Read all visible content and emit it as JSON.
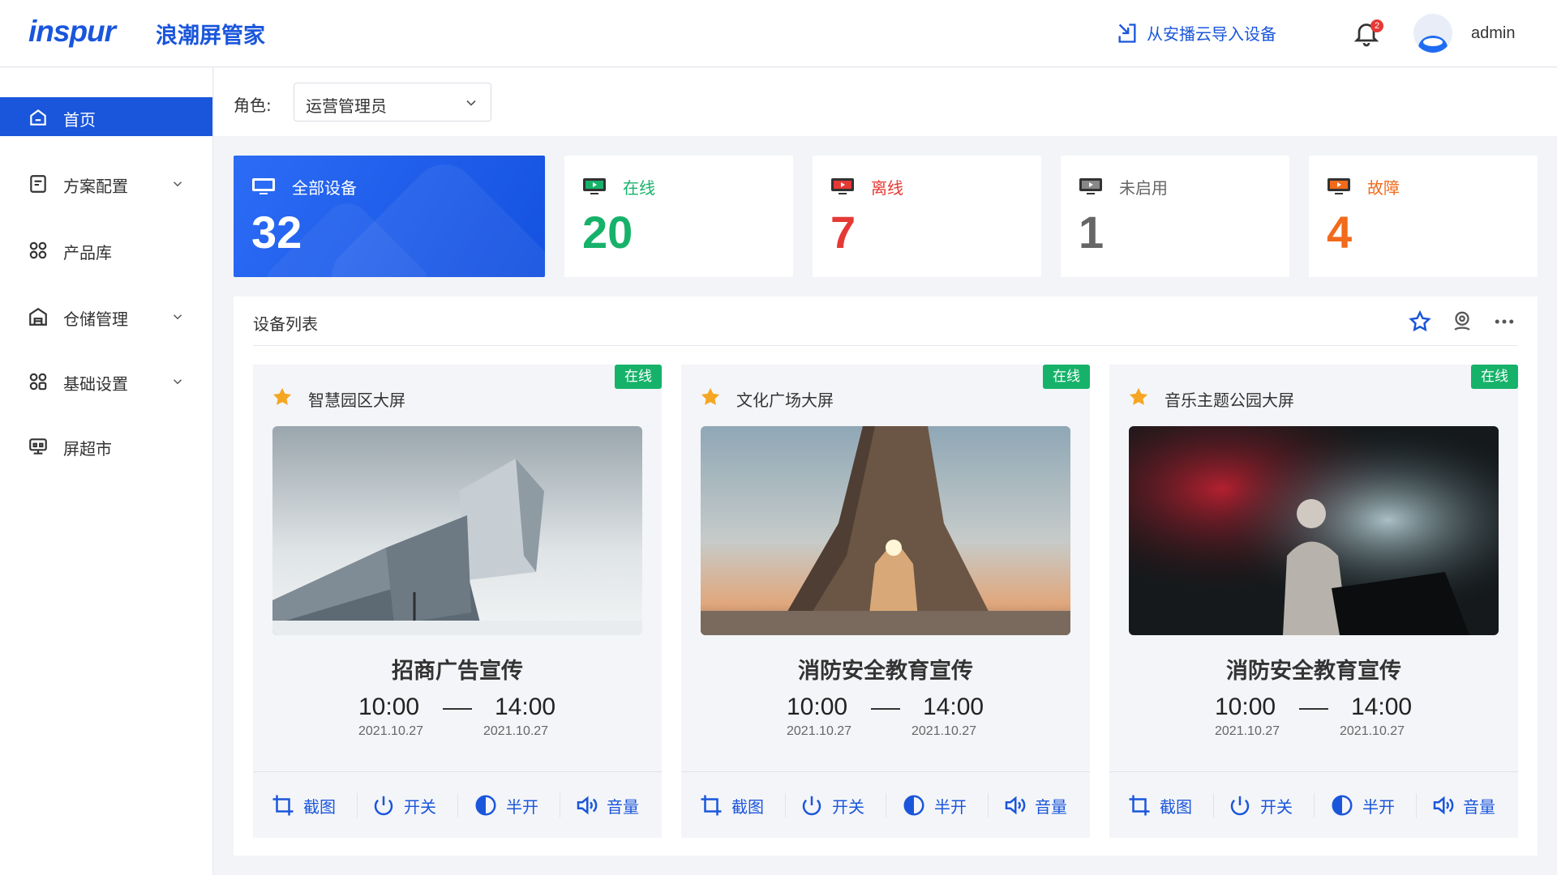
{
  "header": {
    "logo": "inspur",
    "app_title": "浪潮屏管家",
    "import_label": "从安播云导入设备",
    "notification_count": "2",
    "user_name": "admin"
  },
  "sidebar": {
    "items": [
      {
        "label": "首页",
        "icon": "home-icon",
        "active": true
      },
      {
        "label": "方案配置",
        "icon": "document-icon",
        "expandable": true
      },
      {
        "label": "产品库",
        "icon": "grid-icon"
      },
      {
        "label": "仓储管理",
        "icon": "warehouse-icon",
        "expandable": true
      },
      {
        "label": "基础设置",
        "icon": "apps-icon",
        "expandable": true
      },
      {
        "label": "屏超市",
        "icon": "market-icon"
      }
    ]
  },
  "role": {
    "label": "角色:",
    "selected": "运营管理员"
  },
  "stats": [
    {
      "label": "全部设备",
      "value": "32",
      "color": "#ffffff"
    },
    {
      "label": "在线",
      "value": "20",
      "color": "#17b26a"
    },
    {
      "label": "离线",
      "value": "7",
      "color": "#e53935"
    },
    {
      "label": "未启用",
      "value": "1",
      "color": "#666666"
    },
    {
      "label": "故障",
      "value": "4",
      "color": "#f26a1b"
    }
  ],
  "device_list": {
    "title": "设备列表",
    "devices": [
      {
        "name": "智慧园区大屏",
        "status": "在线",
        "program": "招商广告宣传",
        "start_time": "10:00",
        "start_date": "2021.10.27",
        "end_time": "14:00",
        "end_date": "2021.10.27"
      },
      {
        "name": "文化广场大屏",
        "status": "在线",
        "program": "消防安全教育宣传",
        "start_time": "10:00",
        "start_date": "2021.10.27",
        "end_time": "14:00",
        "end_date": "2021.10.27"
      },
      {
        "name": "音乐主题公园大屏",
        "status": "在线",
        "program": "消防安全教育宣传",
        "start_time": "10:00",
        "start_date": "2021.10.27",
        "end_time": "14:00",
        "end_date": "2021.10.27"
      }
    ],
    "actions": [
      "截图",
      "开关",
      "半开",
      "音量"
    ]
  },
  "colors": {
    "primary": "#1a56db",
    "online": "#17b26a",
    "offline": "#e53935",
    "fault": "#f26a1b"
  }
}
